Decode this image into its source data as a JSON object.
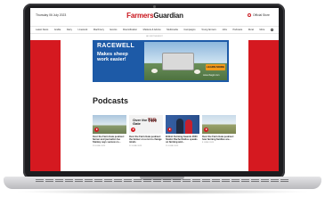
{
  "site": {
    "date": "Thursday 06 July 2023",
    "logo_part1": "Farmers",
    "logo_part2": "Guardian",
    "logo_sub": "",
    "account": "Official Store"
  },
  "nav": [
    "Latest News",
    "Arable",
    "Dairy",
    "Livestock",
    "Machinery",
    "Events",
    "Diversification",
    "Markets & Advice",
    "Multimedia",
    "Campaigns",
    "Young farmers",
    "Jobs",
    "Podcasts",
    "Rural",
    "More"
  ],
  "ad_label": "ADVERTISEMENT",
  "banner": {
    "brand": "RACEWELL",
    "tagline": "Makes sheep work easier!",
    "cta": "LEARN MORE",
    "url": "www.rbagri.com"
  },
  "section_title": "Podcasts",
  "cards": [
    {
      "text": "Over the Farm Gate podcast: farmer and journalist Joe Stanley says success is...",
      "date": "29 JUNE 2023"
    },
    {
      "text": "Over the Farm Gate podcast: the farmer on a run to change minds",
      "date": "22 JUNE 2023",
      "thumb_title": "Over the Farm Gate",
      "thumb_mark": "TIR"
    },
    {
      "text": "British Farming Awards 2023 finalist Rachel Hallos speaks on farming and...",
      "date": "15 JUNE 2023"
    },
    {
      "text": "Over the Farm Gate podcast: how farming families are...",
      "date": "8 JUNE 2023"
    }
  ],
  "colors": {
    "brand_red": "#d51920",
    "banner_blue": "#1d5aa7",
    "cta_orange": "#f29a1c"
  }
}
